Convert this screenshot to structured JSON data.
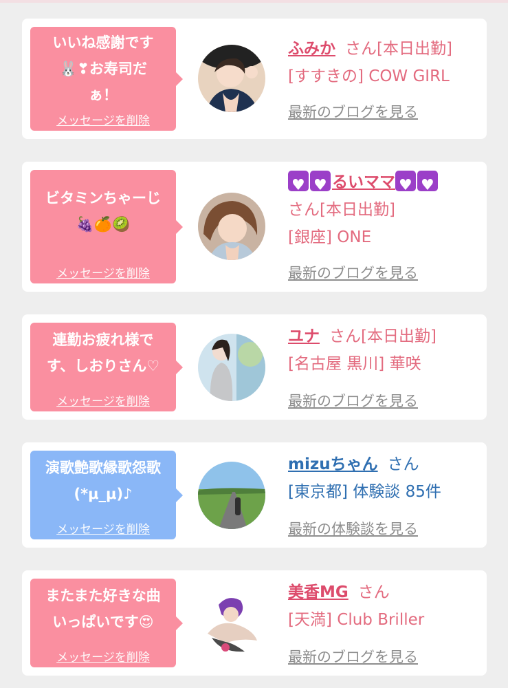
{
  "delete_label": "メッセージを削除",
  "items": [
    {
      "message_lines": [
        "いいね感謝です",
        "🐰❣お寿司だ",
        "ぁ！"
      ],
      "name": "ふみか",
      "san": "さん",
      "status": "[本日出勤]",
      "location_line": "[すすきの] COW GIRL",
      "link": "最新のブログを見る",
      "bubble_color": "#fa8fa0"
    },
    {
      "message_lines": [
        "ビタミンちゃーじ",
        "🍇🍊🥝"
      ],
      "name": "るいママ",
      "san": "さん",
      "status": "[本日出勤]",
      "location_line": "[銀座] ONE",
      "link": "最新のブログを見る",
      "bubble_color": "#fa8fa0"
    },
    {
      "message_lines": [
        "連勤お疲れ様で",
        "す、しおりさん♡"
      ],
      "name": "ユナ",
      "san": "さん",
      "status": "[本日出勤]",
      "location_line": "[名古屋 黒川] 華咲",
      "link": "最新のブログを見る",
      "bubble_color": "#fa8fa0"
    },
    {
      "message_lines": [
        "演歌艶歌縁歌怨歌",
        "(*μ_μ)♪"
      ],
      "name": "mizuちゃん",
      "san": "さん",
      "location_line": "[東京都] 体験談 85件",
      "link": "最新の体験談を見る",
      "bubble_color": "#8ab7f7"
    },
    {
      "message_lines": [
        "またまた好きな曲",
        "いっぱいです😍"
      ],
      "name": "美香MG",
      "san": "さん",
      "location_line": "[天満] Club Briller",
      "link": "最新のブログを見る",
      "bubble_color": "#fa8fa0"
    }
  ]
}
